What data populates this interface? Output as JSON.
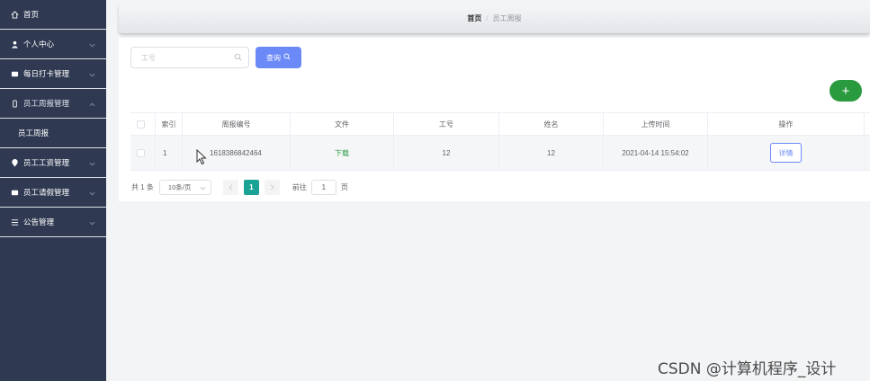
{
  "sidebar": {
    "items": [
      {
        "label": "首页",
        "icon": "home-icon"
      },
      {
        "label": "个人中心",
        "icon": "user-icon"
      },
      {
        "label": "每日打卡管理",
        "icon": "message-icon"
      },
      {
        "label": "员工周报管理",
        "icon": "phone-icon"
      },
      {
        "label": "员工周报"
      },
      {
        "label": "员工工资管理",
        "icon": "location-icon"
      },
      {
        "label": "员工请假管理",
        "icon": "message-icon"
      },
      {
        "label": "公告管理",
        "icon": "list-icon"
      }
    ]
  },
  "breadcrumb": {
    "home": "首页",
    "separator": "/",
    "current": "员工周报"
  },
  "search": {
    "placeholder": "工号",
    "value": ""
  },
  "toolbar": {
    "query_label": "查询",
    "add_label": "+"
  },
  "table": {
    "headers": [
      "索引",
      "周报编号",
      "文件",
      "工号",
      "姓名",
      "上传时间",
      "操作"
    ],
    "rows": [
      {
        "index": "1",
        "report_no": "1618386842464",
        "file": "下载",
        "emp_no": "12",
        "name": "12",
        "upload_time": "2021-04-14 15:54:02",
        "action": "详情"
      }
    ]
  },
  "pagination": {
    "total_text": "共 1 条",
    "page_size": "10条/页",
    "current_page": "1",
    "goto_label": "前往",
    "goto_value": "1",
    "page_unit": "页"
  },
  "watermark": "CSDN @计算机程序_设计",
  "colors": {
    "sidebar_bg": "#2f3a52",
    "primary": "#6b8af7",
    "success": "#2a9a3f",
    "pager_active": "#1aa395"
  }
}
